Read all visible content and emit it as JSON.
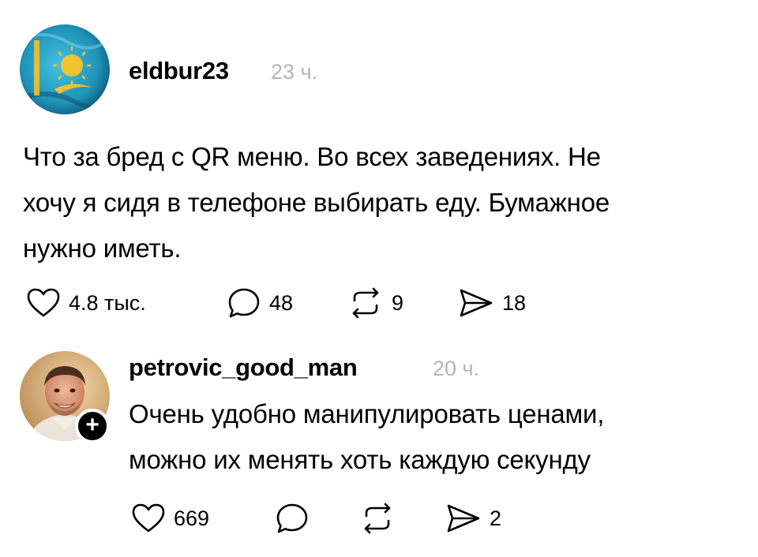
{
  "post": {
    "username": "eldbur23",
    "time": "23 ч.",
    "text_lines": [
      "Что за бред с QR меню. Во всех заведениях. Не",
      "хочу я сидя в телефоне выбирать еду. Бумажное",
      "нужно иметь."
    ],
    "likes": "4.8 тыс.",
    "comments": "48",
    "reposts": "9",
    "shares": "18"
  },
  "reply": {
    "username": "petrovic_good_man",
    "time": "20 ч.",
    "text_lines": [
      "Очень удобно манипулировать ценами,",
      "можно их менять хоть каждую секунду"
    ],
    "likes": "669",
    "shares": "2",
    "follow_badge": "+"
  },
  "icons": {
    "like": "heart-icon",
    "comment": "comment-bubble-icon",
    "repost": "repost-arrows-icon",
    "share": "send-icon"
  },
  "colors": {
    "timestamp": "#b5b5b5",
    "flag_blue": "#2aa6c9",
    "flag_gold": "#f2c230"
  }
}
